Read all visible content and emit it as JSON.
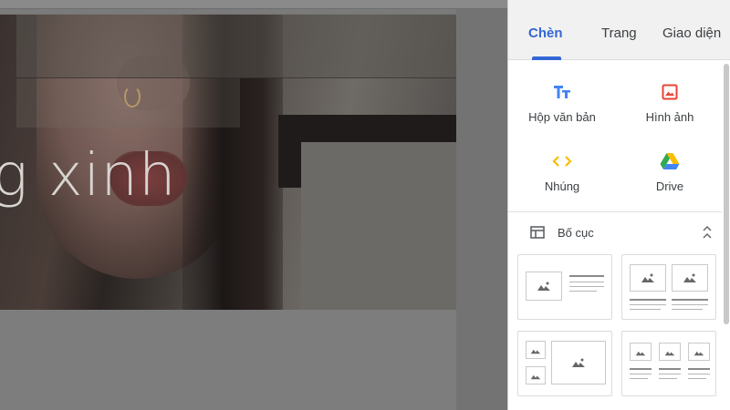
{
  "canvas": {
    "hero_text": "g xinh"
  },
  "panel": {
    "tabs": [
      {
        "label": "Chèn",
        "active": true
      },
      {
        "label": "Trang",
        "active": false
      },
      {
        "label": "Giao diện",
        "active": false
      }
    ],
    "tools": [
      {
        "label": "Hộp văn bản",
        "icon": "text-box-icon",
        "color": "#4285f4"
      },
      {
        "label": "Hình ảnh",
        "icon": "image-icon",
        "color": "#ea4335"
      },
      {
        "label": "Nhúng",
        "icon": "embed-code-icon",
        "color": "#fbbc04"
      },
      {
        "label": "Drive",
        "icon": "google-drive-icon",
        "color": "#34a853"
      }
    ],
    "layout_section": {
      "label": "Bố cục",
      "icon": "layout-icon",
      "collapse_icon": "collapse-icon"
    },
    "accent_color": "#3367d6"
  }
}
